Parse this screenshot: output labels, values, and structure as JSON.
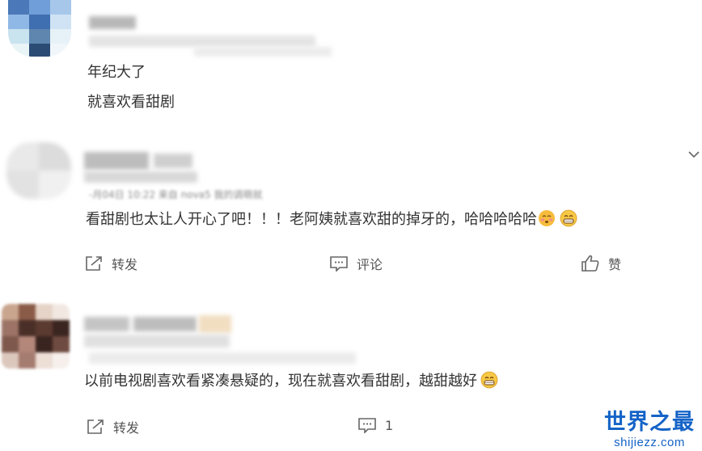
{
  "posts": [
    {
      "lines": [
        "年纪大了",
        "就喜欢看甜剧"
      ]
    },
    {
      "text": "看甜剧也太让人开心了吧！！！老阿姨就喜欢甜的掉牙的，哈哈哈哈哈",
      "meta_blurred": "-月04日 10:22 来自 nova5 我的调萌就",
      "actions": {
        "repost_label": "转发",
        "comment_label": "评论",
        "like_label": "赞"
      }
    },
    {
      "text": "以前电视剧喜欢看紧凑悬疑的，现在就喜欢看甜剧，越甜越好",
      "actions": {
        "repost_label": "转发",
        "comment_count": "1"
      }
    }
  ],
  "watermark": {
    "title": "世界之最",
    "url": "shijiezz.com"
  },
  "colors": {
    "text": "#333333",
    "action": "#555555",
    "watermark": "#1463c7"
  },
  "icons": [
    "repost-icon",
    "comment-icon",
    "like-icon",
    "chevron-down-icon",
    "pensive-emoji-icon",
    "grin-emoji-icon"
  ]
}
